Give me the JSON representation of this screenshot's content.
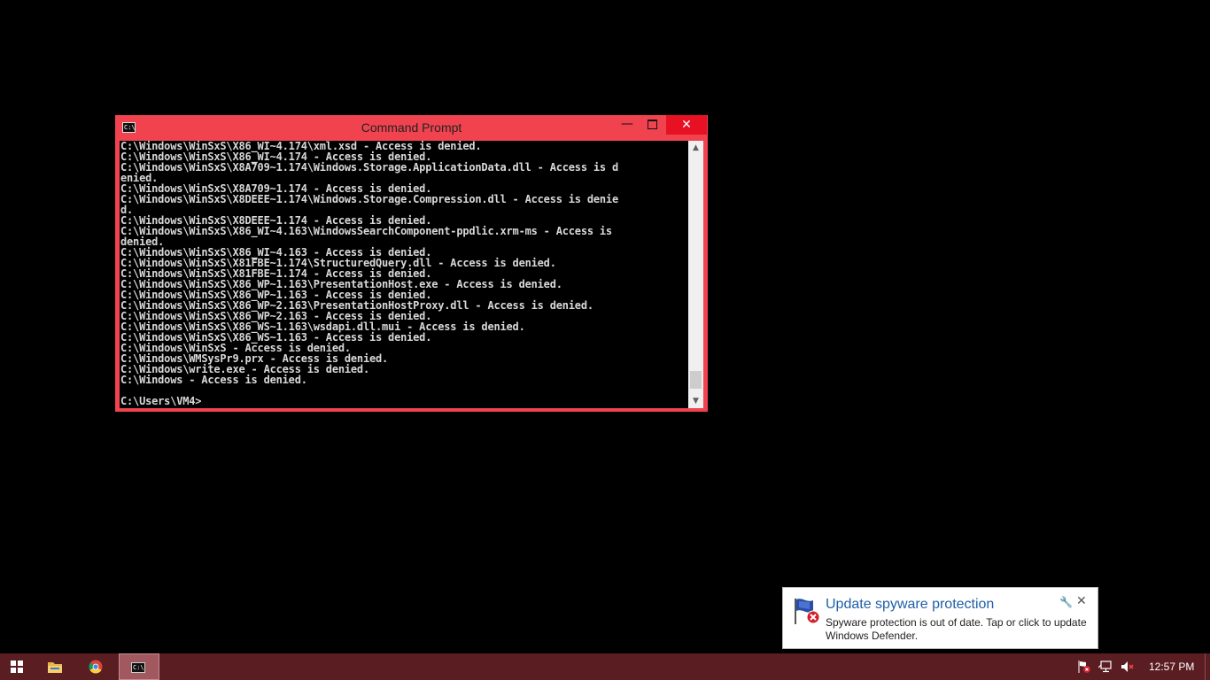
{
  "window": {
    "title": "Command Prompt",
    "console_lines": [
      "C:\\Windows\\WinSxS\\X86_WI~4.174\\xml.xsd - Access is denied.",
      "C:\\Windows\\WinSxS\\X86_WI~4.174 - Access is denied.",
      "C:\\Windows\\WinSxS\\X8A709~1.174\\Windows.Storage.ApplicationData.dll - Access is d",
      "enied.",
      "C:\\Windows\\WinSxS\\X8A709~1.174 - Access is denied.",
      "C:\\Windows\\WinSxS\\X8DEEE~1.174\\Windows.Storage.Compression.dll - Access is denie",
      "d.",
      "C:\\Windows\\WinSxS\\X8DEEE~1.174 - Access is denied.",
      "C:\\Windows\\WinSxS\\X86_WI~4.163\\WindowsSearchComponent-ppdlic.xrm-ms - Access is",
      "denied.",
      "C:\\Windows\\WinSxS\\X86_WI~4.163 - Access is denied.",
      "C:\\Windows\\WinSxS\\X81FBE~1.174\\StructuredQuery.dll - Access is denied.",
      "C:\\Windows\\WinSxS\\X81FBE~1.174 - Access is denied.",
      "C:\\Windows\\WinSxS\\X86_WP~1.163\\PresentationHost.exe - Access is denied.",
      "C:\\Windows\\WinSxS\\X86_WP~1.163 - Access is denied.",
      "C:\\Windows\\WinSxS\\X86_WP~2.163\\PresentationHostProxy.dll - Access is denied.",
      "C:\\Windows\\WinSxS\\X86_WP~2.163 - Access is denied.",
      "C:\\Windows\\WinSxS\\X86_WS~1.163\\wsdapi.dll.mui - Access is denied.",
      "C:\\Windows\\WinSxS\\X86_WS~1.163 - Access is denied.",
      "C:\\Windows\\WinSxS - Access is denied.",
      "C:\\Windows\\WMSysPr9.prx - Access is denied.",
      "C:\\Windows\\write.exe - Access is denied.",
      "C:\\Windows - Access is denied.",
      "",
      "C:\\Users\\VM4>"
    ]
  },
  "notification": {
    "title": "Update spyware protection",
    "body": "Spyware protection is out of date. Tap or click to update Windows Defender."
  },
  "taskbar": {
    "clock": "12:57 PM",
    "pinned": [
      "start-icon",
      "file-explorer-icon",
      "chrome-icon",
      "command-prompt-icon"
    ]
  },
  "colors": {
    "window_frame": "#f0434f",
    "taskbar": "#5a1d22",
    "close_button": "#e81123",
    "notification_title": "#1f5fa8"
  }
}
